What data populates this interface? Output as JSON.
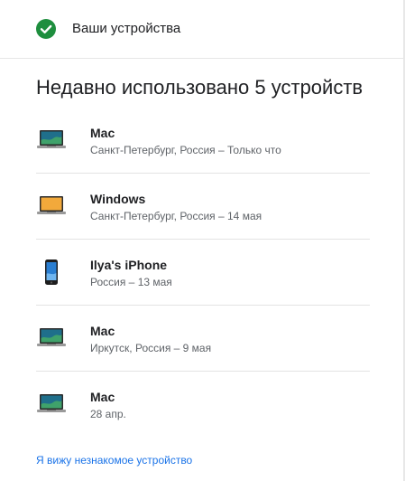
{
  "header": {
    "title": "Ваши устройства",
    "status_color": "#1e8e3e"
  },
  "section": {
    "title": "Недавно использовано 5 устройств"
  },
  "devices": [
    {
      "name": "Mac",
      "details": "Санкт-Петербург, Россия – Только что",
      "icon": "laptop-icon",
      "screen_color": "#1f6f8b"
    },
    {
      "name": "Windows",
      "details": "Санкт-Петербург, Россия – 14 мая",
      "icon": "laptop-icon",
      "screen_color": "#f2a93b"
    },
    {
      "name": "Ilya's iPhone",
      "details": "Россия – 13 мая",
      "icon": "phone-icon",
      "screen_color": "#2a7ed1"
    },
    {
      "name": "Mac",
      "details": "Иркутск, Россия – 9 мая",
      "icon": "laptop-icon",
      "screen_color": "#1f6f8b"
    },
    {
      "name": "Mac",
      "details": "28 апр.",
      "icon": "laptop-icon",
      "screen_color": "#1f6f8b"
    }
  ],
  "footer": {
    "link_label": "Я вижу незнакомое устройство",
    "link_color": "#1a73e8"
  }
}
